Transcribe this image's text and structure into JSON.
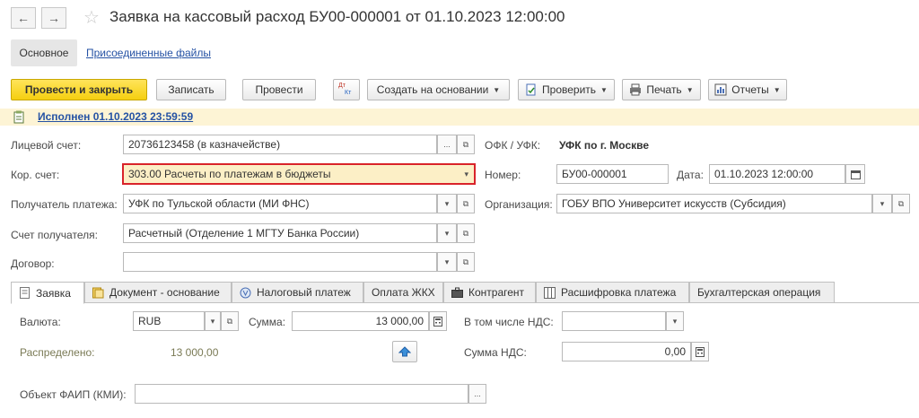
{
  "window": {
    "title": "Заявка на кассовый расход БУ00-000001 от 01.10.2023 12:00:00",
    "back_glyph": "←",
    "forward_glyph": "→",
    "star_glyph": "☆"
  },
  "sections": {
    "main": "Основное",
    "files": "Присоединенные файлы"
  },
  "toolbar": {
    "post_close": "Провести и закрыть",
    "save": "Записать",
    "post": "Провести",
    "create_based": "Создать на основании",
    "check": "Проверить",
    "print": "Печать",
    "reports": "Отчеты",
    "dtkt_icon_dt": "Дт",
    "dtkt_icon_kt": "Кт"
  },
  "status": {
    "text": "Исполнен 01.10.2023 23:59:59"
  },
  "fields": {
    "account_label": "Лицевой счет:",
    "account_value": "20736123458 (в казначействе)",
    "kor_label": "Кор. счет:",
    "kor_value": "303.00 Расчеты по платежам в бюджеты",
    "recipient_label": "Получатель платежа:",
    "recipient_value": "УФК по Тульской области (МИ ФНС)",
    "recipient_acc_label": "Счет получателя:",
    "recipient_acc_value": "Расчетный (Отделение 1 МГТУ Банка России)",
    "contract_label": "Договор:",
    "contract_value": "",
    "ofk_label": "ОФК / УФК:",
    "ofk_value": "УФК по г. Москве",
    "number_label": "Номер:",
    "number_value": "БУ00-000001",
    "date_label": "Дата:",
    "date_value": "01.10.2023 12:00:00",
    "org_label": "Организация:",
    "org_value": "ГОБУ ВПО Университет искусств (Субсидия)",
    "dots": "...",
    "dropdown_glyph": "▾",
    "open_glyph": "⧉"
  },
  "tabs": [
    {
      "label": "Заявка"
    },
    {
      "label": "Документ - основание"
    },
    {
      "label": "Налоговый платеж"
    },
    {
      "label": "Оплата ЖКХ"
    },
    {
      "label": "Контрагент"
    },
    {
      "label": "Расшифровка платежа"
    },
    {
      "label": "Бухгалтерская операция"
    }
  ],
  "request": {
    "currency_label": "Валюта:",
    "currency_value": "RUB",
    "sum_label": "Сумма:",
    "sum_value": "13 000,00",
    "vat_incl_label": "В том числе НДС:",
    "vat_incl_value": "",
    "distributed_label": "Распределено:",
    "distributed_value": "13 000,00",
    "vat_sum_label": "Сумма НДС:",
    "vat_sum_value": "0,00",
    "faip_label": "Объект ФАИП (КМИ):",
    "faip_value": ""
  },
  "colors": {
    "accent_yellow": "#f5cf10",
    "highlight_border": "#d9232a",
    "link_blue": "#2552a4",
    "status_bg": "#fdf4d5"
  }
}
